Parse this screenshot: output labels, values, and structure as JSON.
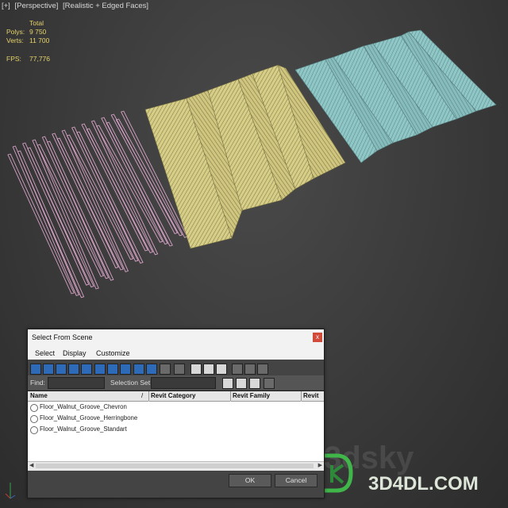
{
  "viewport": {
    "labels": [
      "[+]",
      "[Perspective]",
      "[Realistic + Edged Faces]"
    ],
    "stats": {
      "header": "Total",
      "polys_label": "Polys:",
      "polys_value": "9 750",
      "verts_label": "Verts:",
      "verts_value": "11 700",
      "fps_label": "FPS:",
      "fps_value": "77,776"
    }
  },
  "dialog": {
    "title": "Select From Scene",
    "close_label": "x",
    "menu": [
      "Select",
      "Display",
      "Customize"
    ],
    "find_label": "Find:",
    "selection_set_label": "Selection Set:",
    "columns": [
      "Name",
      "Revit Category",
      "Revit Family",
      "Revit"
    ],
    "sort_indicator": "/",
    "rows": [
      "Floor_Walnut_Groove_Chevron",
      "Floor_Walnut_Groove_Herringbone",
      "Floor_Walnut_Groove_Standart"
    ],
    "ok_label": "OK",
    "cancel_label": "Cancel"
  },
  "watermark": {
    "faded_text": "3dsky",
    "brand_text": "3D4DL.COM"
  },
  "colors": {
    "standart": "#d8a3c7",
    "herringbone": "#ddd48f",
    "chevron": "#8fc8c8"
  }
}
